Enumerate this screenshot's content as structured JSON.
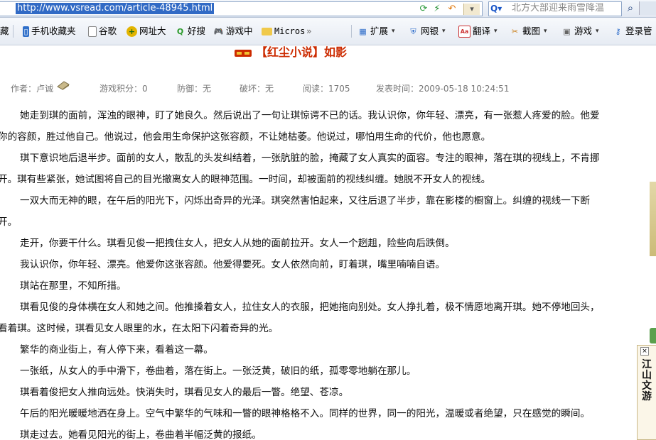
{
  "browser": {
    "url": "http://www.vsread.com/article-48945.html",
    "search_text": "北方大部迎来雨雪降温"
  },
  "toolbar": {
    "items": [
      {
        "label": "藏",
        "icon": "folder-icon"
      },
      {
        "label": "手机收藏夹",
        "icon": "phone-icon"
      },
      {
        "label": "谷歌",
        "icon": "page-icon"
      },
      {
        "label": "网址大",
        "icon": "plus-circle-icon"
      },
      {
        "label": "好搜",
        "icon": "search-q-icon"
      },
      {
        "label": "游戏中",
        "icon": "gamepad-icon"
      },
      {
        "label": "Micros",
        "icon": "folder-icon"
      },
      {
        "label": "»",
        "icon": ""
      },
      {
        "label": "扩展",
        "icon": "grid-icon"
      },
      {
        "label": "网银",
        "icon": "shield-icon"
      },
      {
        "label": "翻译",
        "icon": "translate-icon"
      },
      {
        "label": "截图",
        "icon": "scissors-icon"
      },
      {
        "label": "游戏",
        "icon": "game-icon"
      },
      {
        "label": "登录管",
        "icon": "key-icon"
      }
    ]
  },
  "article": {
    "title": "【红尘小说】如影",
    "meta": {
      "author_label": "作者：",
      "author": "卢诚",
      "game_points": "游戏积分：0",
      "defense": "防御：无",
      "break_armor": "破坏：无",
      "reads": "阅读：1705",
      "published": "发表时间：2009-05-18 10:24:51"
    },
    "lines": [
      {
        "text": "她走到琪的面前，浑浊的眼神，盯了她良久。然后说出了一句让琪惊谔不已的话。我认识你，你年轻、漂亮，有一张惹人疼爱的脸。他爱",
        "cls": "l1"
      },
      {
        "text": "你的容颜，胜过他自己。他说过，他会用生命保护这张容颜，不让她枯萎。他说过，哪怕用生命的代价，他也愿意。",
        "cls": "l2"
      },
      {
        "text": "琪下意识地后退半步。面前的女人，散乱的头发纠结着，一张肮脏的脸，掩藏了女人真实的面容。专注的眼神，落在琪的视线上，不肯挪",
        "cls": "l1"
      },
      {
        "text": "开。琪有些紧张，她试图将自己的目光撤离女人的眼神范围。一时间，却被面前的视线纠缠。她脱不开女人的视线。",
        "cls": "l2"
      },
      {
        "text": "一双大而无神的眼，在午后的阳光下，闪烁出奇异的光泽。琪突然害怕起来，又往后退了半步，靠在影楼的橱窗上。纠缠的视线一下断",
        "cls": "l1"
      },
      {
        "text": "开。",
        "cls": "l2"
      },
      {
        "text": "走开，你要干什么。琪看见俊一把拽住女人，把女人从她的面前拉开。女人一个趔趄，险些向后跌倒。",
        "cls": "l1"
      },
      {
        "text": "我认识你，你年轻、漂亮。他爱你这张容颜。他爱得要死。女人依然向前，盯着琪，嘴里喃喃自语。",
        "cls": "l1"
      },
      {
        "text": "琪站在那里，不知所措。",
        "cls": "l1"
      },
      {
        "text": "琪看见俊的身体横在女人和她之间。他推搡着女人，拉住女人的衣服，把她拖向别处。女人挣扎着，极不情愿地离开琪。她不停地回头，",
        "cls": "l1"
      },
      {
        "text": "看着琪。这时候，琪看见女人眼里的水，在太阳下闪着奇异的光。",
        "cls": "l2"
      },
      {
        "text": "繁华的商业街上，有人停下来，看着这一幕。",
        "cls": "l1"
      },
      {
        "text": "一张纸，从女人的手中滑下，卷曲着，落在街上。一张泛黄，破旧的纸，孤零零地躺在那儿。",
        "cls": "l1"
      },
      {
        "text": "琪看着俊把女人推向远处。快消失时，琪看见女人的最后一瞥。绝望、苍凉。",
        "cls": "l1"
      },
      {
        "text": "午后的阳光暖暖地洒在身上。空气中繁华的气味和一瞥的眼神格格不入。同样的世界，同一的阳光，温暖或者绝望，只在感觉的瞬间。",
        "cls": "l1"
      },
      {
        "text": "琪走过去。她看见阳光的街上，卷曲着半幅泛黄的报纸。",
        "cls": "l1"
      }
    ]
  },
  "side_widget": {
    "text": "江山文游"
  }
}
